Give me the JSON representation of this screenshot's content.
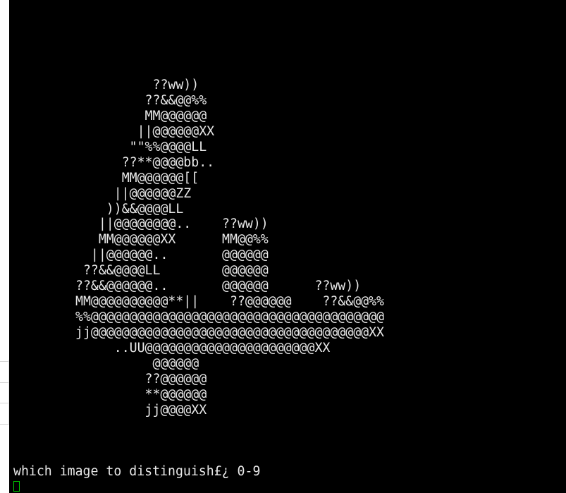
{
  "terminal": {
    "art_lines": [
      "          ??ww))",
      "         ??&&@@%%",
      "         MM@@@@@@",
      "        ||@@@@@@XX",
      "       \"\"%%@@@@LL",
      "      ??**@@@@bb..",
      "      MM@@@@@@[[",
      "     ||@@@@@@ZZ",
      "    ))&&@@@@LL",
      "   ||@@@@@@@@..    ??ww))",
      "   MM@@@@@@XX      MM@@%%",
      "  ||@@@@@@..       @@@@@@",
      " ??&&@@@@LL        @@@@@@",
      "??&&@@@@@@..       @@@@@@      ??ww))",
      "MM@@@@@@@@@@**||    ??@@@@@@    ??&&@@%%",
      "%%@@@@@@@@@@@@@@@@@@@@@@@@@@@@@@@@@@@@@@",
      "jj@@@@@@@@@@@@@@@@@@@@@@@@@@@@@@@@@@@@XX",
      "     ..UU@@@@@@@@@@@@@@@@@@@@@@XX",
      "          @@@@@@",
      "         ??@@@@@@",
      "         **@@@@@@",
      "         jj@@@@XX"
    ],
    "prompt_text": "which image to distinguish£¿ 0-9",
    "colors": {
      "background": "#000000",
      "text": "#e8e8e8",
      "cursor": "#00cc00"
    }
  }
}
